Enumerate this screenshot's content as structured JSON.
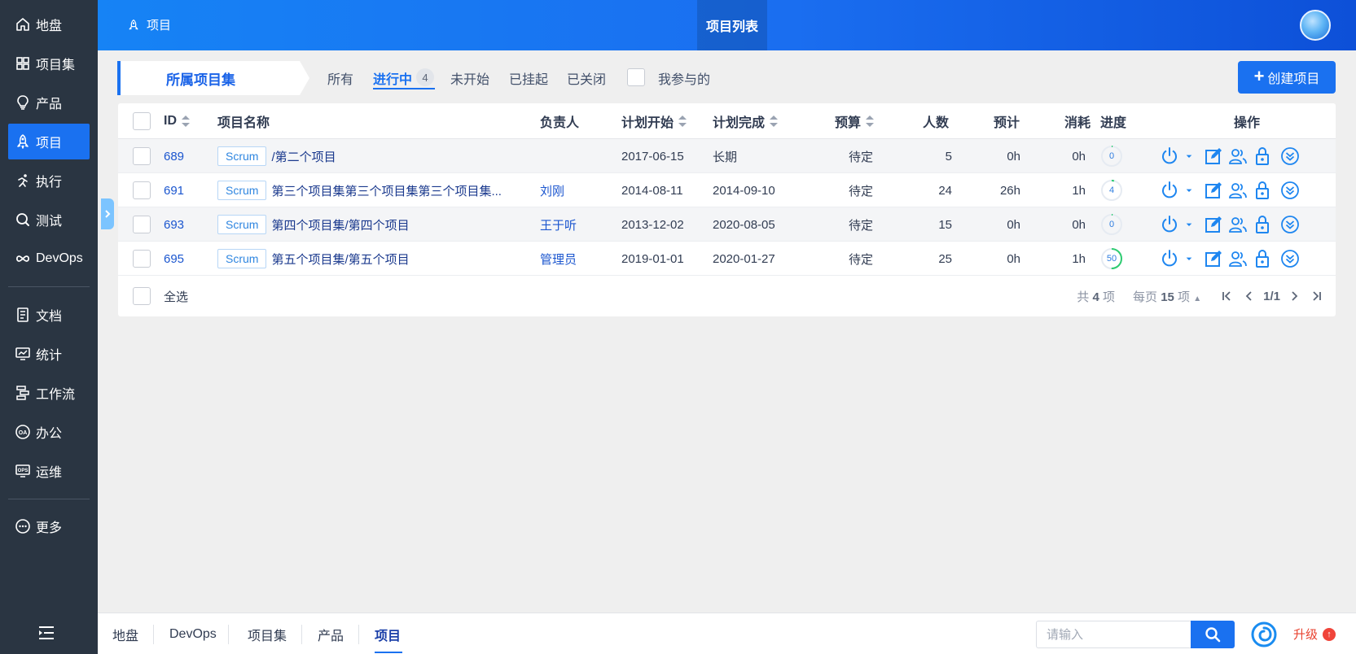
{
  "sidebar": {
    "items": [
      {
        "label": "地盘",
        "icon": "home-icon"
      },
      {
        "label": "项目集",
        "icon": "grid-icon"
      },
      {
        "label": "产品",
        "icon": "bulb-icon"
      },
      {
        "label": "项目",
        "icon": "rocket-icon",
        "active": true
      },
      {
        "label": "执行",
        "icon": "run-icon"
      },
      {
        "label": "测试",
        "icon": "search-bug-icon"
      },
      {
        "label": "DevOps",
        "icon": "infinity-icon"
      },
      {
        "label": "文档",
        "icon": "doc-icon"
      },
      {
        "label": "统计",
        "icon": "monitor-icon"
      },
      {
        "label": "工作流",
        "icon": "workflow-icon"
      },
      {
        "label": "办公",
        "icon": "oa-icon"
      },
      {
        "label": "运维",
        "icon": "ops-icon"
      },
      {
        "label": "更多",
        "icon": "more-icon"
      }
    ]
  },
  "topbar": {
    "module": "项目",
    "title": "项目列表"
  },
  "filters": {
    "set_tab": "所属项目集",
    "all": "所有",
    "doing": "进行中",
    "doing_count": "4",
    "wait": "未开始",
    "suspended": "已挂起",
    "closed": "已关闭",
    "involved": "我参与的"
  },
  "create_button": "创建项目",
  "table": {
    "headers": {
      "id": "ID",
      "name": "项目名称",
      "pm": "负责人",
      "begin": "计划开始",
      "end": "计划完成",
      "budget": "预算",
      "members": "人数",
      "estimate": "预计",
      "consumed": "消耗",
      "progress": "进度",
      "actions": "操作"
    },
    "rows": [
      {
        "id": "689",
        "type": "Scrum",
        "name": "/第二个项目",
        "pm": "",
        "begin": "2017-06-15",
        "end": "长期",
        "budget": "待定",
        "members": "5",
        "estimate": "0h",
        "consumed": "0h",
        "progress": 0
      },
      {
        "id": "691",
        "type": "Scrum",
        "name": "第三个项目集第三个项目集第三个项目集...",
        "pm": "刘刚",
        "begin": "2014-08-11",
        "end": "2014-09-10",
        "budget": "待定",
        "members": "24",
        "estimate": "26h",
        "consumed": "1h",
        "progress": 4
      },
      {
        "id": "693",
        "type": "Scrum",
        "name": "第四个项目集/第四个项目",
        "pm": "王于听",
        "begin": "2013-12-02",
        "end": "2020-08-05",
        "budget": "待定",
        "members": "15",
        "estimate": "0h",
        "consumed": "0h",
        "progress": 0
      },
      {
        "id": "695",
        "type": "Scrum",
        "name": "第五个项目集/第五个项目",
        "pm": "管理员",
        "begin": "2019-01-01",
        "end": "2020-01-27",
        "budget": "待定",
        "members": "25",
        "estimate": "0h",
        "consumed": "1h",
        "progress": 50
      }
    ],
    "select_all": "全选"
  },
  "pager": {
    "total_prefix": "共",
    "total": "4",
    "total_suffix": "项",
    "per_page_prefix": "每页",
    "per_page": "15",
    "per_page_suffix": "项",
    "page": "1/1"
  },
  "bottombar": {
    "crumbs": [
      "地盘",
      "DevOps",
      "项目集",
      "产品",
      "项目"
    ],
    "search_placeholder": "请输入",
    "upgrade": "升级"
  },
  "colors": {
    "primary": "#1a71f0",
    "sidebar": "#2a3542",
    "progress": "#2ecc71"
  }
}
